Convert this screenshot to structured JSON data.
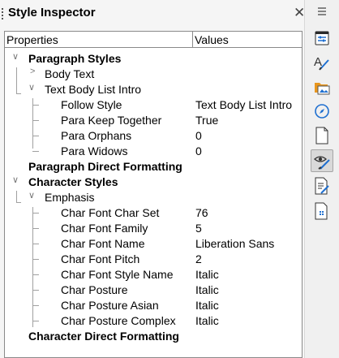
{
  "panel": {
    "title": "Style Inspector"
  },
  "table": {
    "col_properties": "Properties",
    "col_values": "Values"
  },
  "rows": [
    {
      "label": "Paragraph Styles",
      "value": ""
    },
    {
      "label": "Body Text",
      "value": ""
    },
    {
      "label": "Text Body List Intro",
      "value": ""
    },
    {
      "label": "Follow Style",
      "value": "Text Body List Intro"
    },
    {
      "label": "Para Keep Together",
      "value": "True"
    },
    {
      "label": "Para Orphans",
      "value": "0"
    },
    {
      "label": "Para Widows",
      "value": "0"
    },
    {
      "label": "Paragraph Direct Formatting",
      "value": ""
    },
    {
      "label": "Character Styles",
      "value": ""
    },
    {
      "label": "Emphasis",
      "value": ""
    },
    {
      "label": "Char Font Char Set",
      "value": "76"
    },
    {
      "label": "Char Font Family",
      "value": "5"
    },
    {
      "label": "Char Font Name",
      "value": "Liberation Sans"
    },
    {
      "label": "Char Font Pitch",
      "value": "2"
    },
    {
      "label": "Char Font Style Name",
      "value": "Italic"
    },
    {
      "label": "Char Posture",
      "value": "Italic"
    },
    {
      "label": "Char Posture Asian",
      "value": "Italic"
    },
    {
      "label": "Char Posture Complex",
      "value": "Italic"
    },
    {
      "label": "Character Direct Formatting",
      "value": ""
    }
  ],
  "sidebar": {
    "buttons": [
      "properties",
      "styles",
      "gallery",
      "navigator",
      "page",
      "style-inspector",
      "manage-changes",
      "design"
    ],
    "active": "style-inspector"
  },
  "colors": {
    "accent": "#1e6fd0",
    "orange": "#e8961e",
    "tree_line": "#a0a0a0"
  }
}
